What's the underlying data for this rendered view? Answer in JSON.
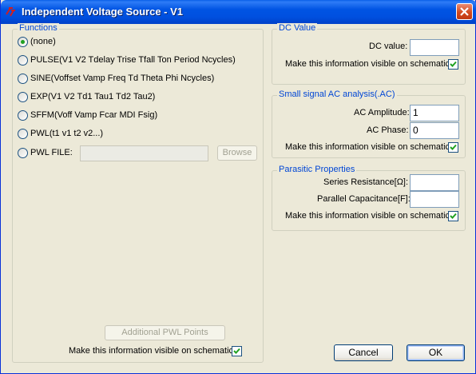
{
  "window": {
    "title": "Independent Voltage Source - V1"
  },
  "functions": {
    "legend": "Functions",
    "options": [
      {
        "label": "(none)",
        "selected": true
      },
      {
        "label": "PULSE(V1 V2 Tdelay Trise Tfall Ton Period Ncycles)",
        "selected": false
      },
      {
        "label": "SINE(Voffset Vamp Freq Td Theta Phi Ncycles)",
        "selected": false
      },
      {
        "label": "EXP(V1 V2 Td1 Tau1 Td2 Tau2)",
        "selected": false
      },
      {
        "label": "SFFM(Voff Vamp Fcar MDI Fsig)",
        "selected": false
      },
      {
        "label": "PWL(t1 v1 t2 v2...)",
        "selected": false
      },
      {
        "label": "PWL FILE:",
        "selected": false
      }
    ],
    "pwl_file_value": "",
    "browse_label": "Browse",
    "additional_pwl_label": "Additional PWL Points",
    "visible_label": "Make this information visible on schematic:",
    "visible_checked": true
  },
  "dc": {
    "legend": "DC Value",
    "value_label": "DC value:",
    "value": "",
    "visible_label": "Make this information visible on schematic:",
    "visible_checked": true
  },
  "ac": {
    "legend": "Small signal AC analysis(.AC)",
    "amplitude_label": "AC Amplitude:",
    "amplitude": "1",
    "phase_label": "AC Phase:",
    "phase": "0",
    "visible_label": "Make this information visible on schematic:",
    "visible_checked": true
  },
  "parasitic": {
    "legend": "Parasitic Properties",
    "resistance_label": "Series Resistance[Ω]:",
    "resistance": "",
    "capacitance_label": "Parallel Capacitance[F]:",
    "capacitance": "",
    "visible_label": "Make this information visible on schematic:",
    "visible_checked": true
  },
  "buttons": {
    "cancel": "Cancel",
    "ok": "OK"
  },
  "colors": {
    "titlebar": "#0054e3",
    "legend": "#0046d5",
    "radio_dot": "#21a121",
    "check": "#21a121"
  },
  "icons": {
    "app": "ltspice-logo-icon",
    "close": "close-icon",
    "check": "checkmark-icon"
  }
}
